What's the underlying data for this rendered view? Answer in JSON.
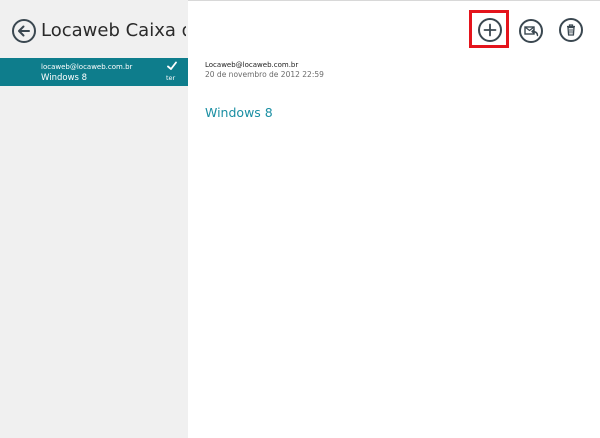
{
  "sidebar": {
    "title": "Locaweb Caixa de...",
    "back_icon": "back-arrow-icon",
    "messages": [
      {
        "from": "locaweb@locaweb.com.br",
        "subject": "Windows 8",
        "day": "ter",
        "selected": true,
        "check_icon": "checkmark-icon"
      }
    ]
  },
  "reading_pane": {
    "from": "Locaweb@locaweb.com.br",
    "date": "20 de novembro de 2012   22:59",
    "subject": "Windows 8"
  },
  "app_bar": {
    "buttons": [
      {
        "icon": "add-icon",
        "highlighted": true
      },
      {
        "icon": "reply-icon",
        "highlighted": false
      },
      {
        "icon": "delete-icon",
        "highlighted": false
      }
    ]
  },
  "colors": {
    "accent": "#0e7d8c",
    "subject_link": "#1b8fa3",
    "sidebar_bg": "#f0f0f0",
    "highlight": "#e4141c"
  }
}
